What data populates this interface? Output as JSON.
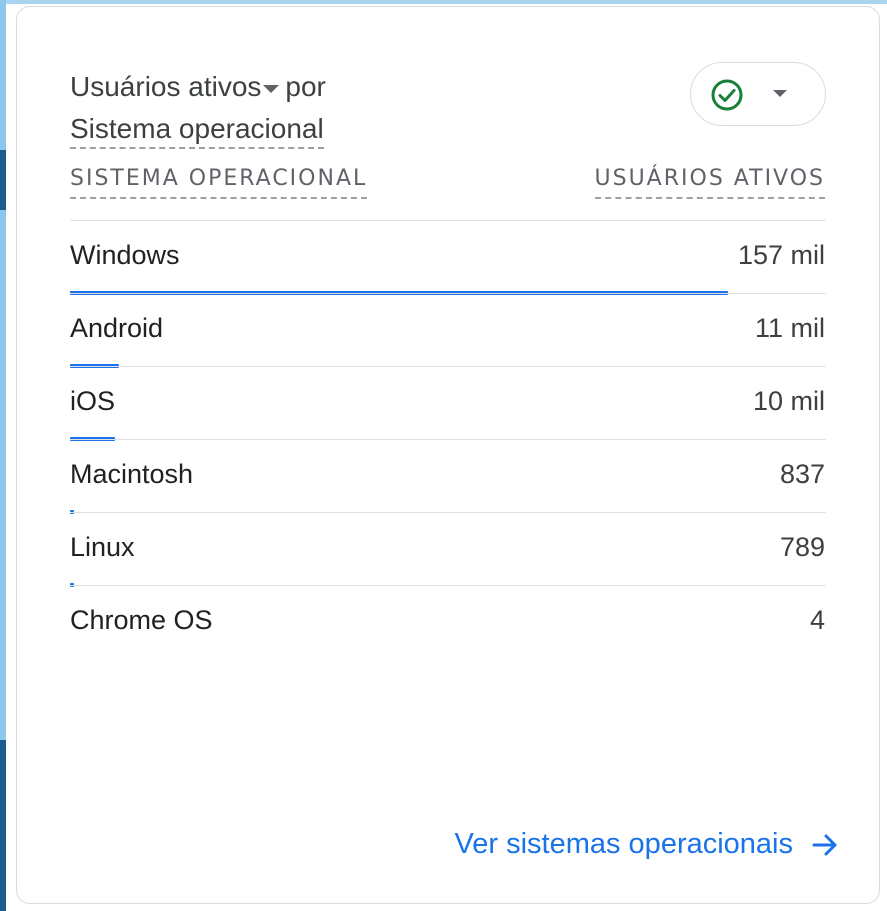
{
  "card": {
    "metric_label": "Usuários ativos",
    "by_word": "por",
    "dimension_label": "Sistema operacional",
    "status_icon": "check-circle-icon",
    "status_color": "#188038"
  },
  "table": {
    "col_dimension": "SISTEMA OPERACIONAL",
    "col_metric": "USUÁRIOS ATIVOS",
    "bar_color": "#1a73e8",
    "rows": [
      {
        "label": "Windows",
        "value": "157 mil",
        "share": 0.87
      },
      {
        "label": "Android",
        "value": "11 mil",
        "share": 0.065
      },
      {
        "label": "iOS",
        "value": "10 mil",
        "share": 0.06
      },
      {
        "label": "Macintosh",
        "value": "837",
        "share": 0.005
      },
      {
        "label": "Linux",
        "value": "789",
        "share": 0.005
      },
      {
        "label": "Chrome OS",
        "value": "4",
        "share": 0.0
      }
    ]
  },
  "footer": {
    "link_label": "Ver sistemas operacionais",
    "link_icon": "arrow-right-icon"
  }
}
